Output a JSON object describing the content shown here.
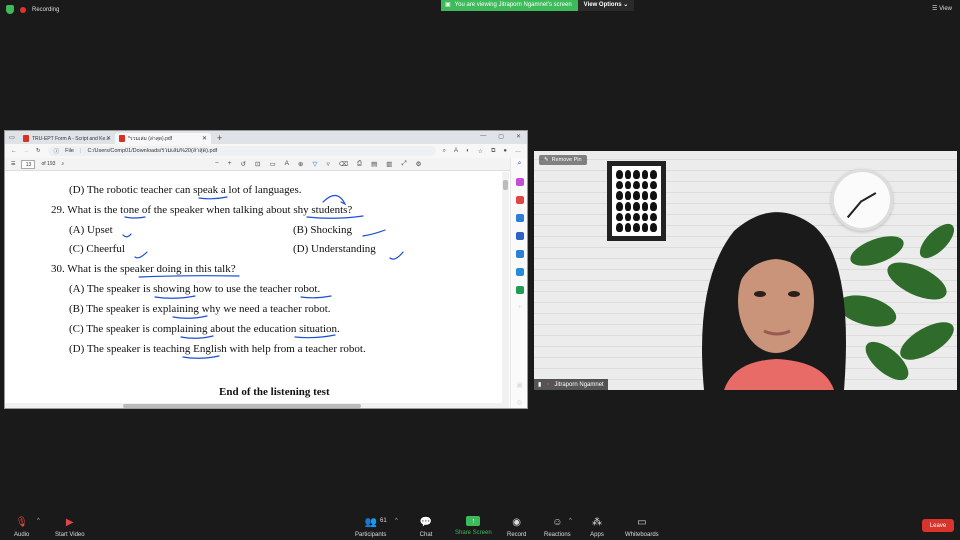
{
  "topbar": {
    "recording_label": "Recording",
    "viewing_banner": "You are viewing Jitraporn Ngamnet's screen",
    "view_options": "View Options",
    "view_button": "View"
  },
  "browser": {
    "tabs": [
      {
        "label": "TRU-EPT Form A - Script and Ke..."
      },
      {
        "label": "*รวมเล่ม (ล่าสุด).pdf"
      }
    ],
    "address_scheme": "File",
    "address": "C:/Users/Comp01/Downloads/รวมเล่ม%20(ล่าสุด).pdf",
    "page_number": "13",
    "page_total": "of 193"
  },
  "document": {
    "lines": [
      {
        "text": "(D) The robotic teacher can speak a lot of languages."
      },
      {
        "text": "29. What is the tone of the speaker when talking about shy students?"
      },
      {
        "text": "(A) Upset"
      },
      {
        "text": "(B) Shocking"
      },
      {
        "text": "(C) Cheerful"
      },
      {
        "text": "(D) Understanding"
      },
      {
        "text": "30. What is the speaker doing in this talk?"
      },
      {
        "text": "(A) The speaker is showing how to use the teacher robot."
      },
      {
        "text": "(B) The speaker is explaining why we need a teacher robot."
      },
      {
        "text": "(C) The speaker is complaining about the education situation."
      },
      {
        "text": "(D) The speaker is teaching English with help from a teacher robot."
      }
    ],
    "end_text": "End of the listening test"
  },
  "video": {
    "remove_pin": "Remove Pin",
    "participant_name": "Jitraporn Ngamnet"
  },
  "toolbar": {
    "audio": "Audio",
    "start_video": "Start Video",
    "participants": "Participants",
    "participants_count": "61",
    "chat": "Chat",
    "share_screen": "Share Screen",
    "record": "Record",
    "reactions": "Reactions",
    "apps": "Apps",
    "whiteboards": "Whiteboards",
    "leave": "Leave"
  },
  "colors": {
    "accent_green": "#3dbb5b",
    "leave_red": "#d9342b",
    "ink_blue": "#1a4fd6"
  }
}
